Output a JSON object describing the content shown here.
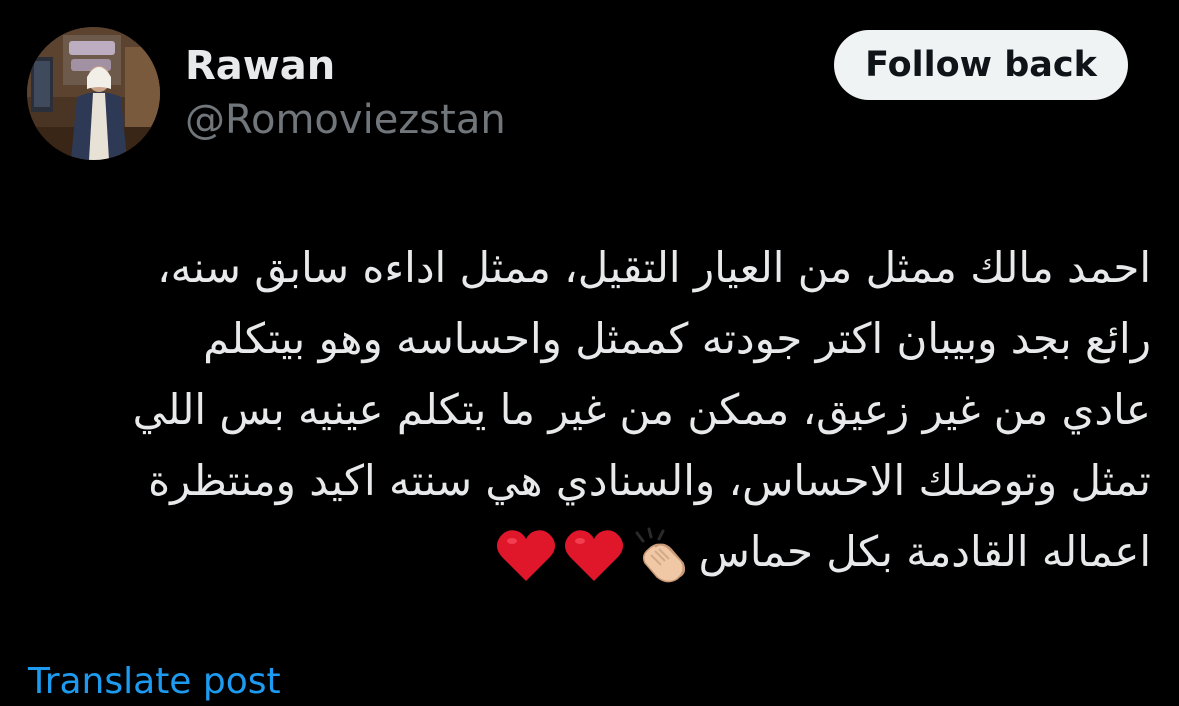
{
  "author": {
    "name": "Rawan",
    "handle": "@Romoviezstan"
  },
  "follow_button": {
    "label": "Follow back"
  },
  "post": {
    "lines": [
      "احمد مالك ممثل من العيار التقيل، ممثل اداءه سابق سنه،",
      "رائع بجد وبيبان اكتر جودته كممثل واحساسه وهو بيتكلم",
      "عادي من غير زعيق، ممكن من غير ما يتكلم عينيه بس اللي",
      "تمثل وتوصلك الاحساس، والسنادي هي سنته اكيد ومنتظرة",
      "اعماله القادمة بكل حماس"
    ],
    "emojis": [
      "clapping-hands",
      "red-heart",
      "red-heart"
    ]
  },
  "translate_link": "Translate post",
  "colors": {
    "background": "#000000",
    "text": "#e7e9ea",
    "secondary": "#71767b",
    "link": "#1d9bf0",
    "button_bg": "#eff3f4",
    "heart": "#e0162b"
  }
}
